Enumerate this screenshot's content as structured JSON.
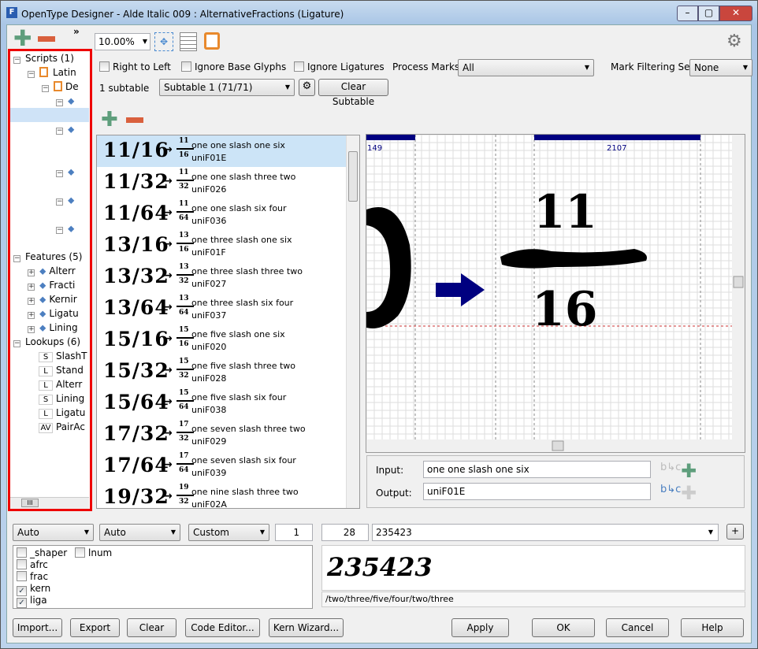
{
  "window": {
    "title": "OpenType Designer - Alde Italic 009 : AlternativeFractions (Ligature)",
    "controls": [
      "minimize",
      "maximize",
      "close"
    ]
  },
  "toolbar": {
    "zoom": "10.00%",
    "expand": "»"
  },
  "tree": {
    "scripts": "Scripts (1)",
    "latin": "Latin",
    "default": "De",
    "features": "Features (5)",
    "feature_items": [
      "Alterr",
      "Fracti",
      "Kernir",
      "Ligatu",
      "Lining"
    ],
    "lookups": "Lookups (6)",
    "lookup_items": [
      {
        "type": "S",
        "label": "SlashT"
      },
      {
        "type": "L",
        "label": "Stand"
      },
      {
        "type": "L",
        "label": "Alterr"
      },
      {
        "type": "S",
        "label": "Lining"
      },
      {
        "type": "L",
        "label": "Ligatu"
      },
      {
        "type": "AV",
        "label": "PairAc"
      }
    ]
  },
  "options": {
    "right_to_left": "Right to Left",
    "ignore_base": "Ignore Base Glyphs",
    "ignore_ligatures": "Ignore Ligatures",
    "process_marks_label": "Process Marks:",
    "process_marks": "All",
    "mark_filter_label": "Mark Filtering Set:",
    "mark_filter": "None",
    "subtable_count": "1 subtable",
    "subtable": "Subtable 1 (71/71)",
    "clear_subtable": "Clear Subtable"
  },
  "rules": [
    {
      "glyphs": "11/16",
      "numer": "11",
      "denom": "16",
      "input": "one one slash one six",
      "output": "uniF01E"
    },
    {
      "glyphs": "11/32",
      "numer": "11",
      "denom": "32",
      "input": "one one slash three two",
      "output": "uniF026"
    },
    {
      "glyphs": "11/64",
      "numer": "11",
      "denom": "64",
      "input": "one one slash six four",
      "output": "uniF036"
    },
    {
      "glyphs": "13/16",
      "numer": "13",
      "denom": "16",
      "input": "one three slash one six",
      "output": "uniF01F"
    },
    {
      "glyphs": "13/32",
      "numer": "13",
      "denom": "32",
      "input": "one three slash three two",
      "output": "uniF027"
    },
    {
      "glyphs": "13/64",
      "numer": "13",
      "denom": "64",
      "input": "one three slash six four",
      "output": "uniF037"
    },
    {
      "glyphs": "15/16",
      "numer": "15",
      "denom": "16",
      "input": "one five slash one six",
      "output": "uniF020"
    },
    {
      "glyphs": "15/32",
      "numer": "15",
      "denom": "32",
      "input": "one five slash three two",
      "output": "uniF028"
    },
    {
      "glyphs": "15/64",
      "numer": "15",
      "denom": "64",
      "input": "one five slash six four",
      "output": "uniF038"
    },
    {
      "glyphs": "17/32",
      "numer": "17",
      "denom": "32",
      "input": "one seven slash three two",
      "output": "uniF029"
    },
    {
      "glyphs": "17/64",
      "numer": "17",
      "denom": "64",
      "input": "one seven slash six four",
      "output": "uniF039"
    },
    {
      "glyphs": "19/32",
      "numer": "19",
      "denom": "32",
      "input": "one nine slash three two",
      "output": "uniF02A"
    }
  ],
  "canvas": {
    "left_advance": "149",
    "right_advance": "2107",
    "numer": "11",
    "denom": "16",
    "glyph_color": "#000000",
    "arrow_color": "#000080"
  },
  "editor": {
    "input_label": "Input:",
    "input_value": "one one slash one six",
    "output_label": "Output:",
    "output_value": "uniF01E"
  },
  "preview": {
    "script": "Auto",
    "language": "Auto",
    "mode": "Custom",
    "spin1": "1",
    "size": "28",
    "text": "235423",
    "add": "+",
    "rendered": "235423",
    "glyph_names": "/two/three/five/four/two/three"
  },
  "features": [
    {
      "tag": "_shaper",
      "checked": false
    },
    {
      "tag": "afrc",
      "checked": false
    },
    {
      "tag": "frac",
      "checked": false
    },
    {
      "tag": "kern",
      "checked": true
    },
    {
      "tag": "liga",
      "checked": true
    },
    {
      "tag": "lnum",
      "checked": false
    }
  ],
  "buttons": {
    "import": "Import...",
    "export": "Export",
    "clear": "Clear",
    "code_editor": "Code Editor...",
    "kern_wizard": "Kern Wizard...",
    "apply": "Apply",
    "ok": "OK",
    "cancel": "Cancel",
    "help": "Help"
  }
}
